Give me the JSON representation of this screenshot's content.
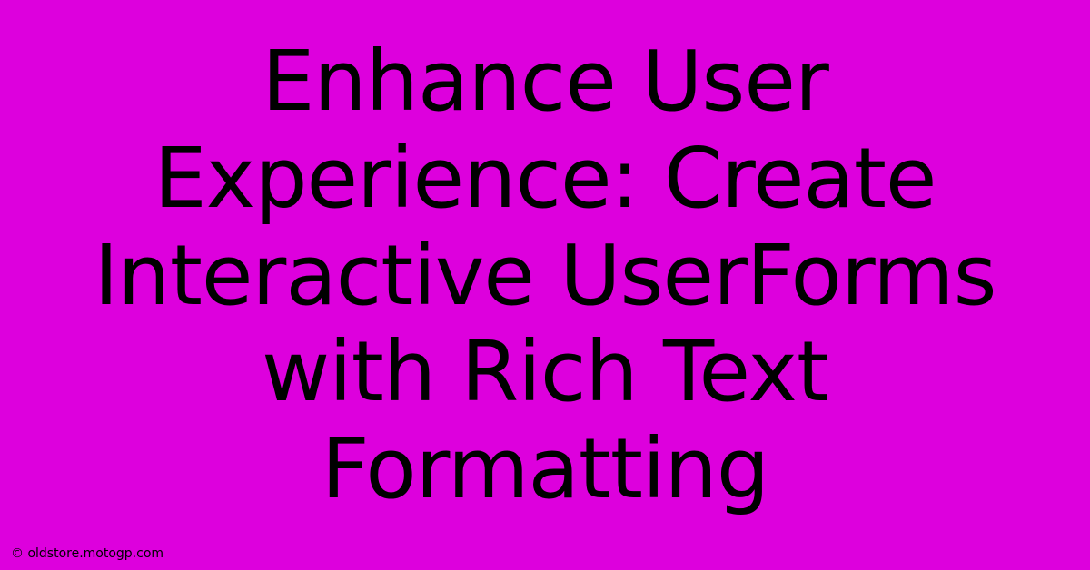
{
  "headline": "Enhance User Experience: Create Interactive UserForms with Rich Text Formatting",
  "attribution": "© oldstore.motogp.com",
  "colors": {
    "background": "#dd00dd",
    "text": "#000000"
  }
}
